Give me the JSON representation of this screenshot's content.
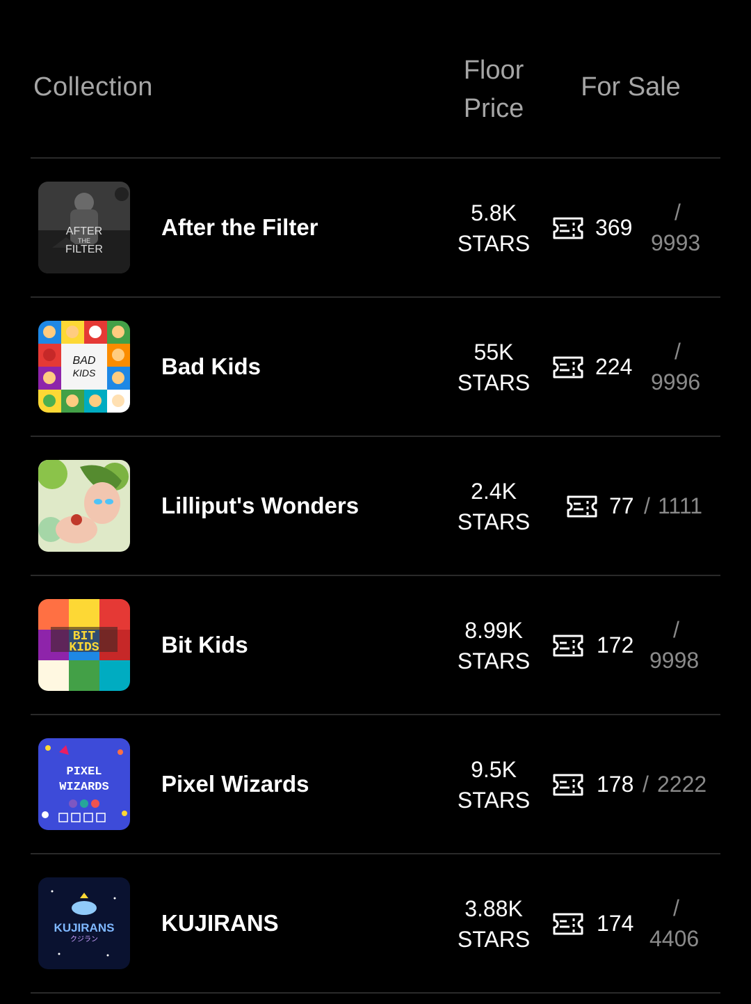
{
  "header": {
    "collection": "Collection",
    "floor_line1": "Floor",
    "floor_line2": "Price",
    "for_sale": "For Sale"
  },
  "rows": [
    {
      "name": "After the Filter",
      "price_value": "5.8K",
      "price_unit": "STARS",
      "for_sale": "369",
      "separator": "/",
      "supply": "9993",
      "thumb_text": [
        "AFTER",
        "THE",
        "FILTER"
      ]
    },
    {
      "name": "Bad Kids",
      "price_value": "55K",
      "price_unit": "STARS",
      "for_sale": "224",
      "separator": "/",
      "supply": "9996",
      "thumb_text": [
        "BAD",
        "KIDS"
      ]
    },
    {
      "name": "Lilliput's Wonders",
      "price_value": "2.4K",
      "price_unit": "STARS",
      "for_sale": "77",
      "separator": "/",
      "supply": "1111"
    },
    {
      "name": "Bit Kids",
      "price_value": "8.99K",
      "price_unit": "STARS",
      "for_sale": "172",
      "separator": "/",
      "supply": "9998",
      "thumb_text": [
        "BIT",
        "KIDS"
      ]
    },
    {
      "name": "Pixel Wizards",
      "price_value": "9.5K",
      "price_unit": "STARS",
      "for_sale": "178",
      "separator": "/",
      "supply": "2222",
      "thumb_text": [
        "PIXEL",
        "WIZARDS"
      ]
    },
    {
      "name": "KUJIRANS",
      "price_value": "3.88K",
      "price_unit": "STARS",
      "for_sale": "174",
      "separator": "/",
      "supply": "4406",
      "thumb_text": [
        "KUJIRANS",
        "クジラン"
      ]
    }
  ],
  "icons": {
    "for_sale_icon": "ticket-icon"
  },
  "colors": {
    "background": "#000000",
    "muted": "#8a8a8a",
    "header": "#a6a6a6",
    "divider": "#2a2a2a"
  }
}
